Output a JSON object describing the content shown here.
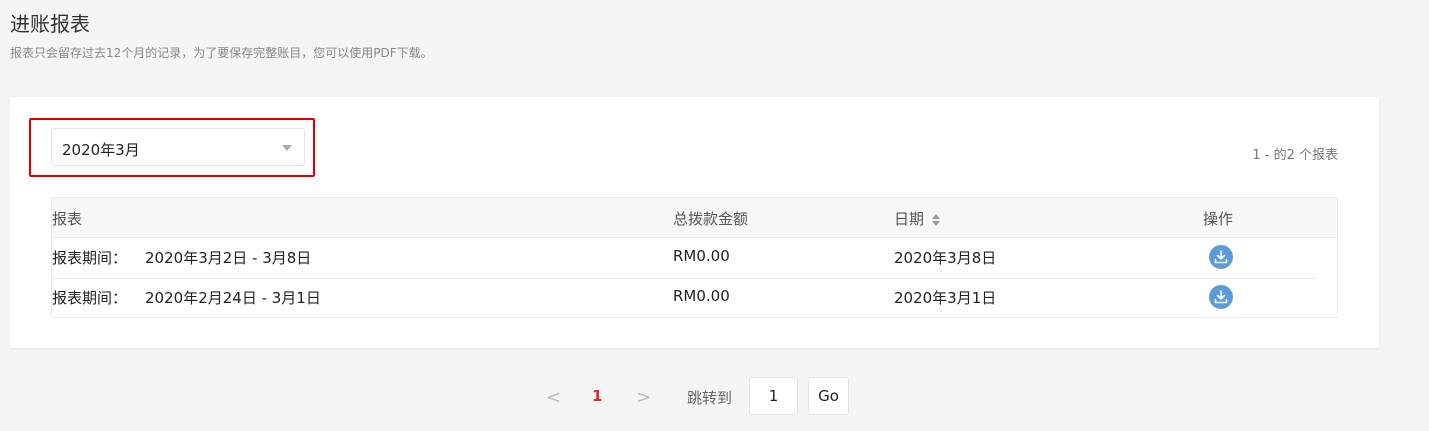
{
  "header": {
    "title": "进账报表",
    "subtitle": "报表只会留存过去12个月的记录，为了要保存完整账目，您可以使用PDF下载。"
  },
  "filter": {
    "selected_month": "2020年3月",
    "result_count": "1 - 的2 个报表"
  },
  "table": {
    "columns": {
      "report": "报表",
      "total": "总拨款金额",
      "date": "日期",
      "action": "操作"
    },
    "rows": [
      {
        "period_label": "报表期间：",
        "period": "2020年3月2日 - 3月8日",
        "amount": "RM0.00",
        "date": "2020年3月8日",
        "action_icon": "download-icon"
      },
      {
        "period_label": "报表期间：",
        "period": "2020年2月24日 - 3月1日",
        "amount": "RM0.00",
        "date": "2020年3月1日",
        "action_icon": "download-icon"
      }
    ]
  },
  "pagination": {
    "prev": "<",
    "current_page": "1",
    "next": ">",
    "jump_label": "跳转到",
    "jump_value": "1",
    "go_label": "Go"
  },
  "colors": {
    "accent_red": "#e02a2a",
    "highlight_border": "#e00000",
    "download_blue": "#5b9bdc"
  }
}
